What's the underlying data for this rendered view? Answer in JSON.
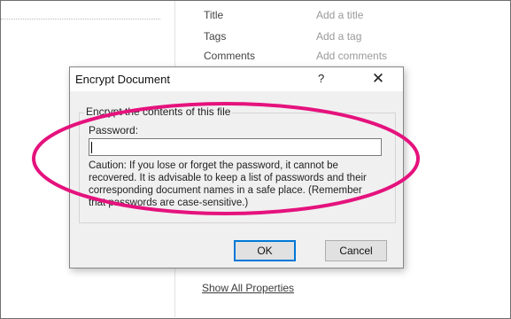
{
  "properties": {
    "items": [
      {
        "label": "Title",
        "value": "Add a title"
      },
      {
        "label": "Tags",
        "value": "Add a tag"
      },
      {
        "label": "Comments",
        "value": "Add comments"
      }
    ],
    "show_all_label": "Show All Properties"
  },
  "dialog": {
    "title": "Encrypt Document",
    "help_label": "?",
    "close_label": "✕",
    "group_label": "Encrypt the contents of this file",
    "password_label": "Password:",
    "password_value": "",
    "caution_text": "Caution: If you lose or forget the password, it cannot be recovered. It is advisable to keep a list of passwords and their corresponding document names in a safe place. (Remember that passwords are case-sensitive.)",
    "ok_label": "OK",
    "cancel_label": "Cancel"
  },
  "colors": {
    "annotation": "#e5127d",
    "accent": "#0078d7"
  }
}
